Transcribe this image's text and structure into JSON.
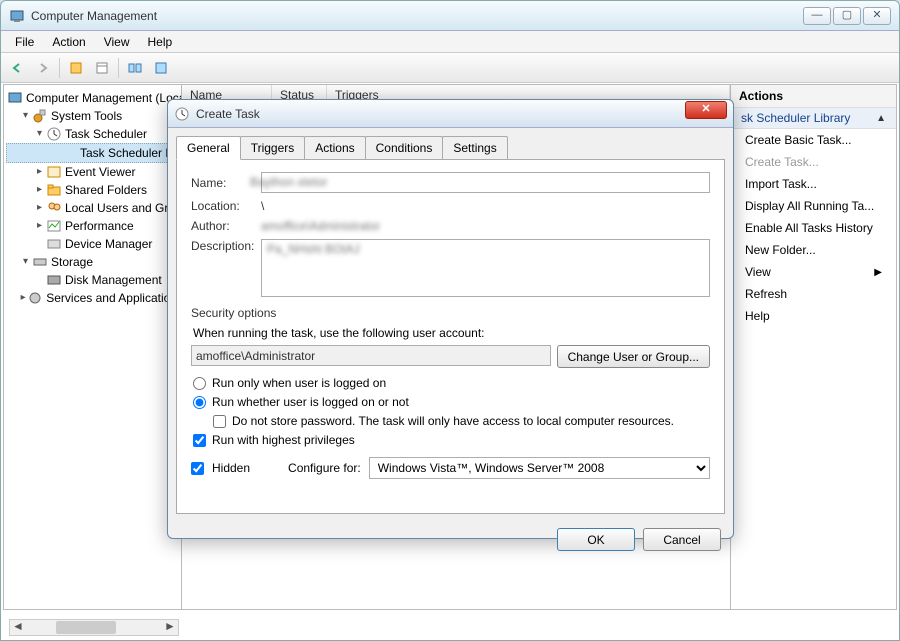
{
  "window": {
    "title": "Computer Management",
    "controls": {
      "min": "—",
      "max": "▢",
      "close": "✕"
    }
  },
  "menu": {
    "file": "File",
    "action": "Action",
    "view": "View",
    "help": "Help"
  },
  "tree": {
    "root": "Computer Management (Local",
    "system_tools": "System Tools",
    "task_scheduler": "Task Scheduler",
    "task_scheduler_lib": "Task Scheduler L",
    "event_viewer": "Event Viewer",
    "shared_folders": "Shared Folders",
    "local_users": "Local Users and Gro",
    "performance": "Performance",
    "device_manager": "Device Manager",
    "storage": "Storage",
    "disk_management": "Disk Management",
    "services_apps": "Services and Application"
  },
  "columns": {
    "name": "Name",
    "status": "Status",
    "triggers": "Triggers"
  },
  "actions": {
    "title": "Actions",
    "section": "sk Scheduler Library",
    "create_basic": "Create Basic Task...",
    "create_task": "Create Task...",
    "import_task": "Import Task...",
    "display_all": "Display All Running Ta...",
    "enable_history": "Enable All Tasks History",
    "new_folder": "New Folder...",
    "view": "View",
    "refresh": "Refresh",
    "help": "Help"
  },
  "dialog": {
    "title": "Create Task",
    "tabs": {
      "general": "General",
      "triggers": "Triggers",
      "actions": "Actions",
      "conditions": "Conditions",
      "settings": "Settings"
    },
    "labels": {
      "name": "Name:",
      "location": "Location:",
      "author": "Author:",
      "description": "Description:"
    },
    "values": {
      "name": "Baython xtetor",
      "location": "\\",
      "author": "amoffice\\Administrator",
      "description": "Pa_NHsht BOtAJ"
    },
    "security": {
      "title": "Security options",
      "when_running": "When running the task, use the following user account:",
      "account": "amoffice\\Administrator",
      "change_user": "Change User or Group...",
      "run_logged_on": "Run only when user is logged on",
      "run_whether": "Run whether user is logged on or not",
      "no_store_pwd": "Do not store password.  The task will only have access to local computer resources.",
      "highest_priv": "Run with highest privileges"
    },
    "hidden_label": "Hidden",
    "configure_label": "Configure for:",
    "configure_value": "Windows Vista™, Windows Server™ 2008",
    "ok": "OK",
    "cancel": "Cancel"
  }
}
